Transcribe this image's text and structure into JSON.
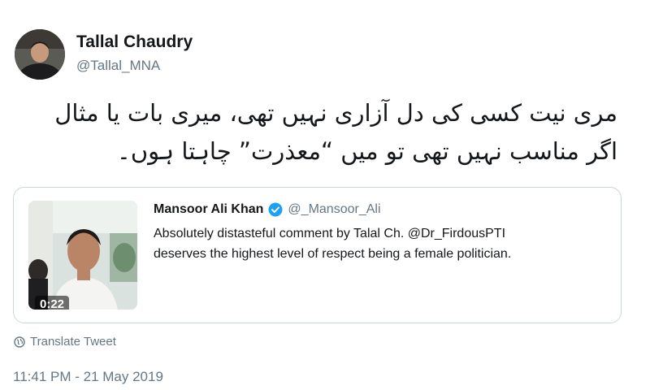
{
  "tweet": {
    "author": {
      "name": "Tallal Chaudry",
      "handle": "@Tallal_MNA",
      "avatar_icon": "profile-photo"
    },
    "text_lines": [
      "مری نیت کسی کی دل آزاری نہیں تھی، میری بات یا مثال",
      "اگر مناسب نہیں تھی تو میں “معذرت” چاہتا ہوں۔"
    ],
    "quoted": {
      "name": "Mansoor Ali Khan",
      "verified": true,
      "handle": "@_Mansoor_Ali",
      "text_lines": [
        "Absolutely distasteful comment by Talal Ch. @Dr_FirdousPTI",
        "deserves the highest level of respect being a female politician."
      ],
      "video": {
        "duration": "0:22"
      }
    },
    "translate_label": "Translate Tweet",
    "timestamp": "11:41 PM - 21 May 2019"
  },
  "colors": {
    "primary_text": "#14171a",
    "secondary_text": "#657786",
    "verified_blue": "#1da1f2",
    "card_border": "#ccd6dd"
  }
}
